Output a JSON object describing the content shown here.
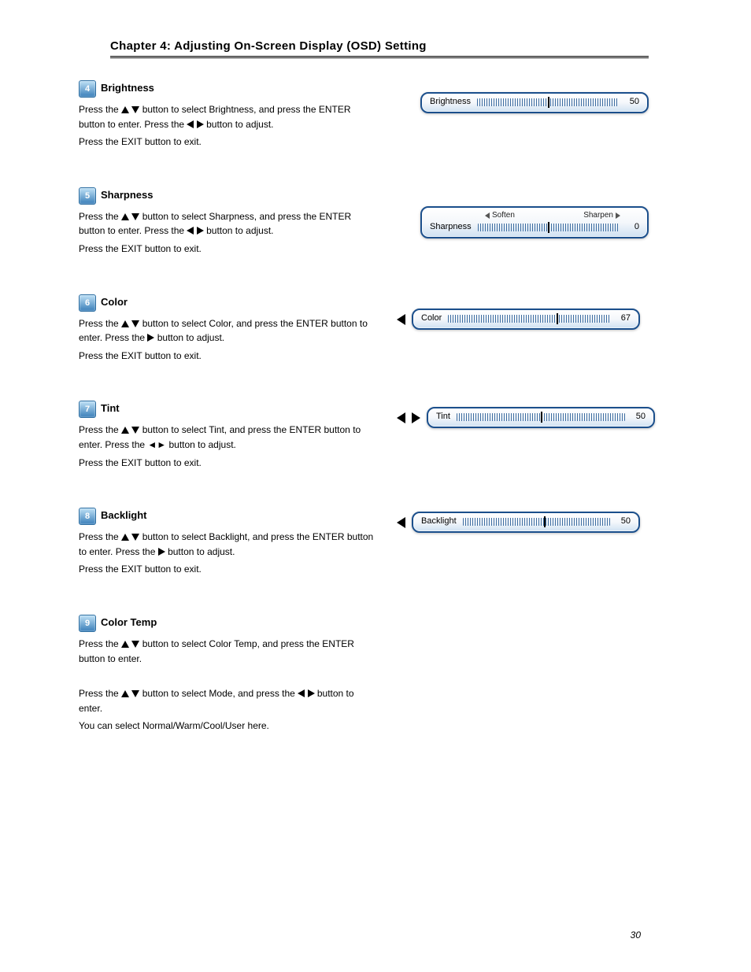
{
  "chapter_title": "Chapter 4: Adjusting On-Screen Display (OSD) Setting",
  "page_number": "30",
  "sliders": {
    "brightness": {
      "label": "Brightness",
      "value": "50",
      "percent": 50
    },
    "sharpness": {
      "label": "Sharpness",
      "value": "0",
      "percent": 50,
      "left_hint": "Soften",
      "right_hint": "Sharpen"
    },
    "color": {
      "label": "Color",
      "value": "67",
      "percent": 67
    },
    "tint": {
      "label": "Tint",
      "value": "50",
      "percent": 50
    },
    "backlight": {
      "label": "Backlight",
      "value": "50",
      "percent": 55
    }
  },
  "sections": [
    {
      "num": "4",
      "title": "Brightness",
      "lines": [
        "Press the {UD} button to select Brightness, and press the ENTER button to enter. Press the {LR} button to adjust.",
        "Press the EXIT button to exit."
      ],
      "has_slider": "brightness",
      "nav": "none"
    },
    {
      "num": "5",
      "title": "Sharpness",
      "lines": [
        "Press the {UD} button to select Sharpness, and press the ENTER button to enter. Press the {LR} button to adjust.",
        "Press the EXIT button to exit."
      ],
      "has_slider": "sharpness",
      "nav": "none"
    },
    {
      "num": "6",
      "title": "Color",
      "lines": [
        "Press the {UD} button to select Color, and press the ENTER button to enter. Press the {R} button to adjust.",
        "Press the EXIT button to exit."
      ],
      "has_slider": "color",
      "nav": "left"
    },
    {
      "num": "7",
      "title": "Tint",
      "lines": [
        "Press the {UD} button to select Tint, and press the ENTER button to enter. Press the ◄► button to adjust.",
        "Press the EXIT button to exit."
      ],
      "has_slider": "tint",
      "nav": "both"
    },
    {
      "num": "8",
      "title": "Backlight",
      "lines": [
        "Press the {UD} button to select Backlight, and press the ENTER button to enter. Press the {R} button to adjust.",
        "Press the EXIT button to exit."
      ],
      "has_slider": "backlight",
      "nav": "left"
    },
    {
      "num": "9",
      "title": "Color Temp",
      "lines": [
        "Press the {UD} button to select Color Temp, and press the ENTER button to enter."
      ]
    },
    {
      "num": "",
      "title": "",
      "lines": [
        "Press the {UD} button to select Mode, and press the {LRsmall} button to enter.",
        "You can select Normal/Warm/Cool/User here."
      ]
    }
  ]
}
